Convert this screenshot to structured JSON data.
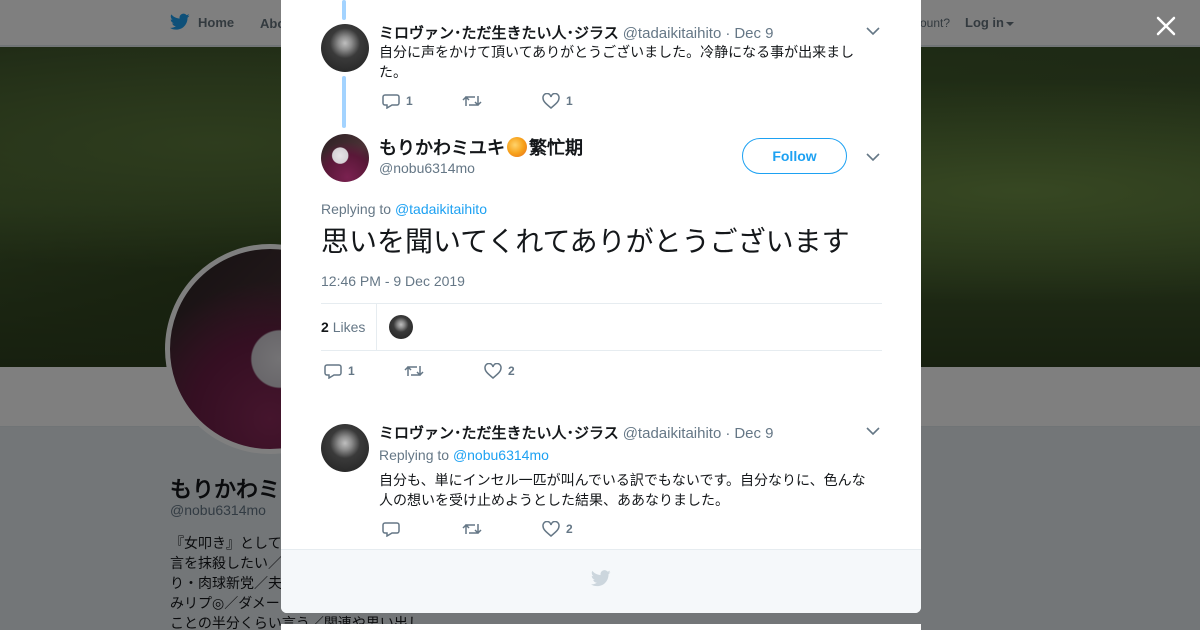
{
  "nav": {
    "home_label": "Home",
    "about_label": "Abo",
    "account_prompt": "ccount?",
    "login_label": "Log in"
  },
  "profile": {
    "name": "もりかわミ",
    "handle": "@nobu6314mo",
    "bio_lines": [
      "『女叩き』として",
      "言を抹殺したい／",
      "り・肉球新党／夫",
      "みリプ◎／ダメー",
      "ことの半分くらい言う／関連や思い出し"
    ]
  },
  "modal": {
    "tweet1": {
      "name": "ミロヴァン･ただ生きたい人･ジラス",
      "handle": "@tadaikitaihito",
      "date": "Dec 9",
      "text": "自分に声をかけて頂いてありがとうございました。冷静になる事が出来ました。",
      "replies": "1",
      "retweets": "",
      "likes": "1"
    },
    "main": {
      "name": "もりかわミユキ",
      "name_suffix": "繁忙期",
      "handle": "@nobu6314mo",
      "follow_label": "Follow",
      "replying_prefix": "Replying to",
      "replying_to": "@tadaikitaihito",
      "text": "思いを聞いてくれてありがとうございます",
      "timestamp": "12:46 PM - 9 Dec 2019",
      "likes_count": "2",
      "likes_label": "Likes",
      "replies": "1",
      "retweets": "",
      "likes": "2"
    },
    "tweet3": {
      "name": "ミロヴァン･ただ生きたい人･ジラス",
      "handle": "@tadaikitaihito",
      "date": "Dec 9",
      "replying_prefix": "Replying to",
      "replying_to": "@nobu6314mo",
      "text": "自分も、単にインセル一匹が叫んでいる訳でもないです。自分なりに、色んな人の想いを受け止めようとした結果、ああなりました。",
      "replies": "",
      "retweets": "",
      "likes": "2"
    }
  },
  "colors": {
    "accent": "#1da1f2",
    "thread_line": "#a3d3ff",
    "muted": "#657786"
  }
}
